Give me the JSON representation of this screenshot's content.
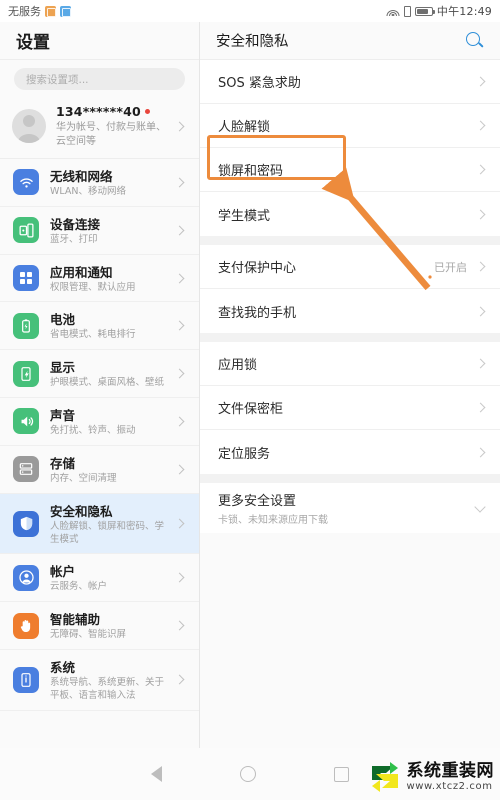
{
  "status_bar": {
    "carrier": "无服务",
    "left_icons": [
      "app-icon-orange",
      "app-icon-blue"
    ],
    "right_icons": [
      "wifi-icon",
      "sim-card-icon",
      "battery-icon"
    ],
    "time": "中午12:49"
  },
  "left_pane": {
    "title": "设置",
    "search": {
      "placeholder": "搜索设置项..."
    },
    "account": {
      "name": "134******40",
      "subtitle": "华为帐号、付款与账单、云空间等",
      "has_red_dot": true
    },
    "items": [
      {
        "title": "无线和网络",
        "subtitle": "WLAN、移动网络",
        "icon": "wifi-icon",
        "color": "#4a7fe0",
        "active": false
      },
      {
        "title": "设备连接",
        "subtitle": "蓝牙、打印",
        "icon": "device-connect-icon",
        "color": "#46c07a",
        "active": false
      },
      {
        "title": "应用和通知",
        "subtitle": "权限管理、默认应用",
        "icon": "apps-grid-icon",
        "color": "#4a7fe0",
        "active": false
      },
      {
        "title": "电池",
        "subtitle": "省电模式、耗电排行",
        "icon": "battery-icon",
        "color": "#46c07a",
        "active": false
      },
      {
        "title": "显示",
        "subtitle": "护眼模式、桌面风格、壁纸",
        "icon": "display-icon",
        "color": "#46c07a",
        "active": false
      },
      {
        "title": "声音",
        "subtitle": "免打扰、铃声、振动",
        "icon": "sound-icon",
        "color": "#46c07a",
        "active": false
      },
      {
        "title": "存储",
        "subtitle": "内存、空间清理",
        "icon": "storage-icon",
        "color": "#9a9a9a",
        "active": false
      },
      {
        "title": "安全和隐私",
        "subtitle": "人脸解锁、锁屏和密码、学生模式",
        "icon": "shield-icon",
        "color": "#3d72d7",
        "active": true
      },
      {
        "title": "帐户",
        "subtitle": "云服务、帐户",
        "icon": "account-icon",
        "color": "#4a7fe0",
        "active": false
      },
      {
        "title": "智能辅助",
        "subtitle": "无障碍、智能识屏",
        "icon": "hand-icon",
        "color": "#ef7d2e",
        "active": false
      },
      {
        "title": "系统",
        "subtitle": "系统导航、系统更新、关于平板、语言和输入法",
        "icon": "system-info-icon",
        "color": "#4a7fe0",
        "active": false
      }
    ]
  },
  "right_pane": {
    "title": "安全和隐私",
    "search_icon": "search-icon",
    "search_icon_color": "#2f8fd8",
    "groups": [
      {
        "rows": [
          {
            "label": "SOS 紧急求助",
            "value": "",
            "chevron": "chevron-right-icon"
          },
          {
            "label": "人脸解锁",
            "value": "",
            "chevron": "chevron-right-icon"
          },
          {
            "label": "锁屏和密码",
            "value": "",
            "chevron": "chevron-right-icon",
            "highlighted": true
          },
          {
            "label": "学生模式",
            "value": "",
            "chevron": "chevron-right-icon"
          }
        ]
      },
      {
        "rows": [
          {
            "label": "支付保护中心",
            "value": "已开启",
            "chevron": "chevron-right-icon"
          },
          {
            "label": "查找我的手机",
            "value": "",
            "chevron": "chevron-right-icon"
          }
        ]
      },
      {
        "rows": [
          {
            "label": "应用锁",
            "value": "",
            "chevron": "chevron-right-icon"
          },
          {
            "label": "文件保密柜",
            "value": "",
            "chevron": "chevron-right-icon"
          },
          {
            "label": "定位服务",
            "value": "",
            "chevron": "chevron-right-icon"
          }
        ]
      },
      {
        "rows": [
          {
            "label": "更多安全设置",
            "subtitle": "卡锁、未知来源应用下载",
            "value": "",
            "chevron": "chevron-down-icon"
          }
        ]
      }
    ]
  },
  "annotation": {
    "highlight_color": "#ed8b3c",
    "highlight_target": "锁屏和密码",
    "arrow": "pointer-arrow"
  },
  "navbar": {
    "back": "back-triangle-icon",
    "home": "home-circle-icon",
    "recents": "recents-square-icon"
  },
  "watermark": {
    "name": "系统重装网",
    "url": "www.xtcz2.com"
  }
}
